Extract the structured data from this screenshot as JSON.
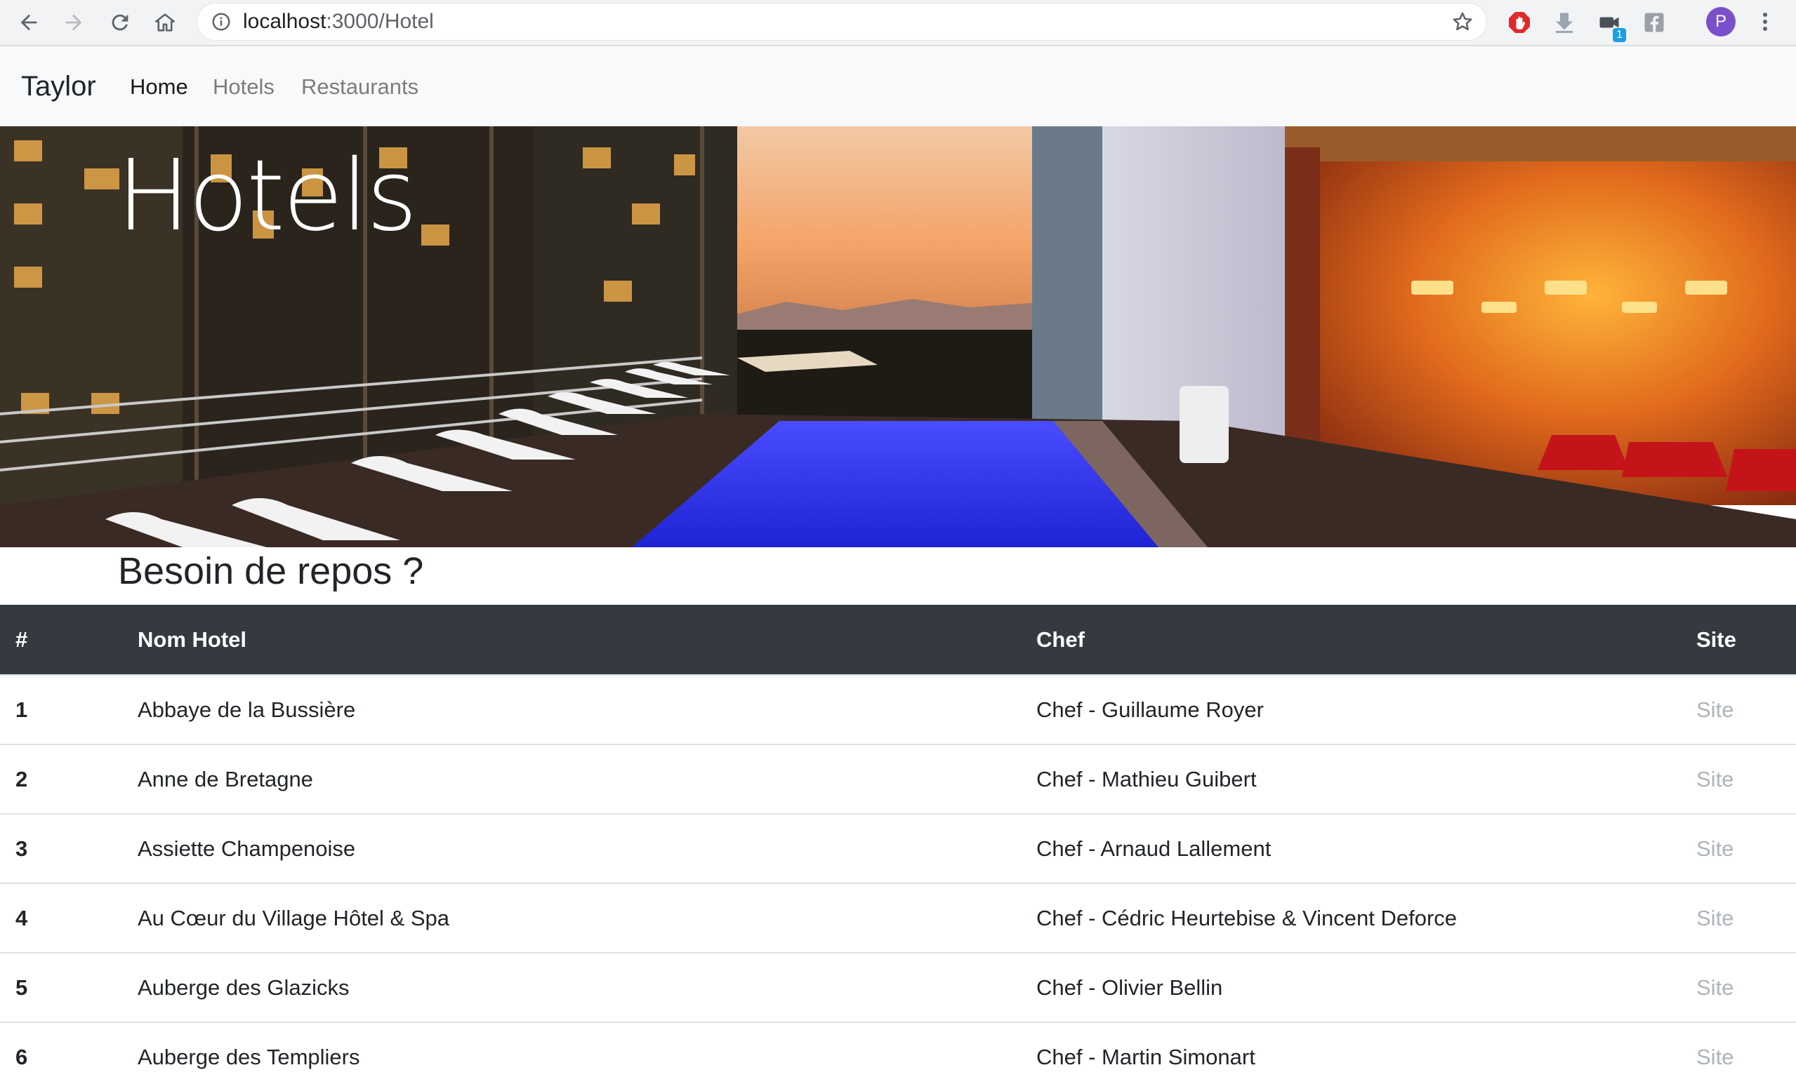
{
  "browser": {
    "url_host": "localhost",
    "url_path": ":3000/Hotel",
    "profile_initial": "P",
    "extension_badge": "1"
  },
  "navbar": {
    "brand": "Taylor",
    "links": [
      {
        "label": "Home",
        "active": true
      },
      {
        "label": "Hotels",
        "active": false
      },
      {
        "label": "Restaurants",
        "active": false
      }
    ]
  },
  "hero": {
    "title": "Hotels"
  },
  "page": {
    "subtitle": "Besoin de repos ?"
  },
  "table": {
    "headers": [
      "#",
      "Nom Hotel",
      "Chef",
      "Site"
    ],
    "rows": [
      {
        "num": "1",
        "name": "Abbaye de la Bussière",
        "chef": "Chef - Guillaume Royer",
        "site": "Site"
      },
      {
        "num": "2",
        "name": "Anne de Bretagne",
        "chef": "Chef - Mathieu Guibert",
        "site": "Site"
      },
      {
        "num": "3",
        "name": "Assiette Champenoise",
        "chef": "Chef - Arnaud Lallement",
        "site": "Site"
      },
      {
        "num": "4",
        "name": "Au Cœur du Village Hôtel & Spa",
        "chef": "Chef - Cédric Heurtebise & Vincent Deforce",
        "site": "Site"
      },
      {
        "num": "5",
        "name": "Auberge des Glazicks",
        "chef": "Chef - Olivier Bellin",
        "site": "Site"
      },
      {
        "num": "6",
        "name": "Auberge des Templiers",
        "chef": "Chef - Martin Simonart",
        "site": "Site"
      }
    ]
  },
  "colors": {
    "table_header_bg": "#343a40",
    "navbar_bg": "#f8f9fa",
    "link_muted": "#aeb4ba",
    "avatar_bg": "#7b4fc9"
  }
}
